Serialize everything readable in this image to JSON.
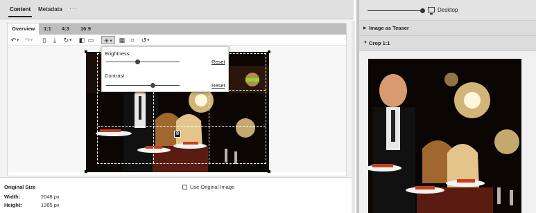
{
  "top_tabs": [
    "Content",
    "Metadata"
  ],
  "top_more": "···",
  "ratio_tabs": [
    "Overview",
    "1:1",
    "4:3",
    "16:9"
  ],
  "toolbar_icons": [
    "undo-icon",
    "redo-icon",
    "delete-icon",
    "download-icon",
    "rotate-icon",
    "compare-icon",
    "settings-icon",
    "brightness-icon",
    "grid-icon",
    "crop-icon",
    "reset-icon"
  ],
  "adjust": {
    "brightness_label": "Brightness",
    "brightness_value": 0.42,
    "contrast_label": "Contrast",
    "contrast_value": 0.65,
    "reset_label": "Reset"
  },
  "info": {
    "title": "Original Size",
    "width_label": "Width:",
    "width_value": "2048 px",
    "height_label": "Height:",
    "height_value": "1365 px",
    "use_original_label": "Use Original Image"
  },
  "preview": {
    "device_label": "Desktop",
    "device_slider_value": 1.0,
    "sections": [
      {
        "title": "Image as Teaser",
        "expanded": false
      },
      {
        "title": "Crop 1:1",
        "expanded": true
      }
    ]
  },
  "colors": {
    "accent": "#222222",
    "panel": "#dcdcdc"
  }
}
